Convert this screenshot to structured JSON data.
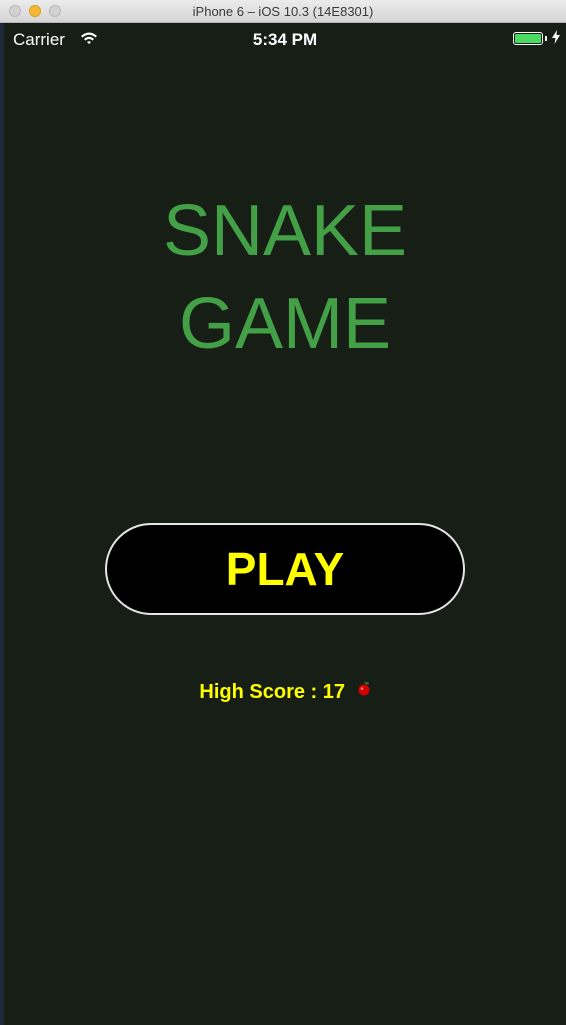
{
  "window": {
    "title": "iPhone 6 – iOS 10.3 (14E8301)"
  },
  "statusbar": {
    "carrier": "Carrier",
    "time": "5:34 PM",
    "battery_level": 1.0
  },
  "game": {
    "title_line1": "SNAKE",
    "title_line2": "GAME",
    "play_label": "PLAY",
    "high_score_label": "High Score",
    "high_score_separator": " : ",
    "high_score_value": "17",
    "high_score_icon": "apple-icon"
  },
  "colors": {
    "background": "#161e16",
    "title": "#43a047",
    "play_text": "#ffff00",
    "play_background": "#000000",
    "score_text": "#ffff00"
  }
}
